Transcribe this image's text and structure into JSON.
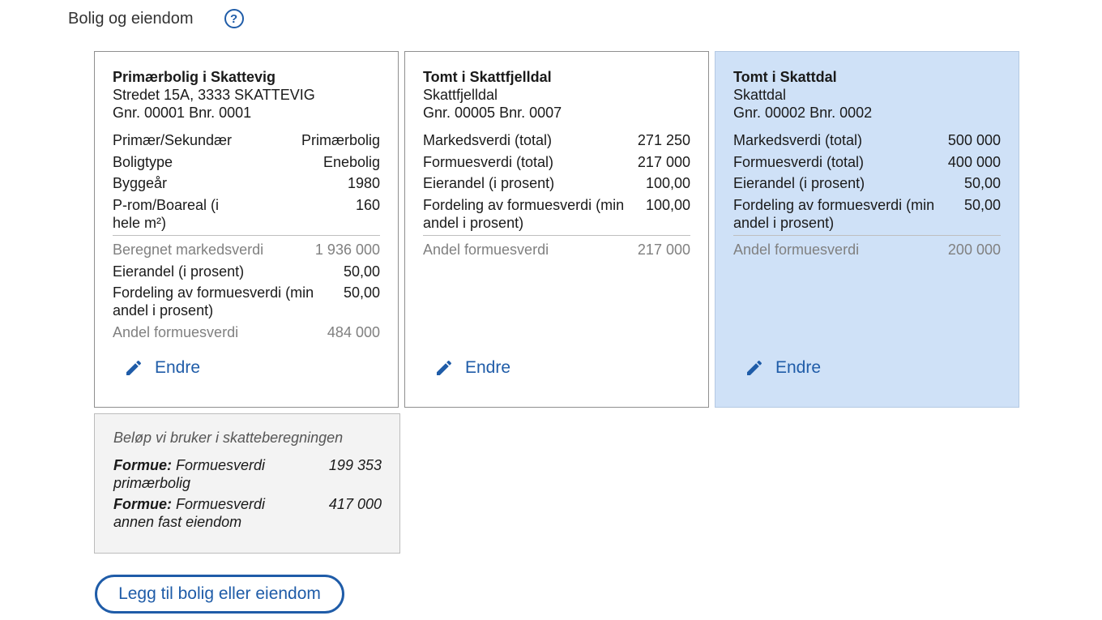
{
  "section": {
    "title": "Bolig og eiendom",
    "help_icon": "?"
  },
  "cards": [
    {
      "title": "Primærbolig i Skattevig",
      "line1": "Stredet 15A, 3333 SKATTEVIG",
      "line2": "Gnr. 00001 Bnr. 0001",
      "rows": [
        {
          "label": "Primær/Sekundær",
          "value": "Primærbolig"
        },
        {
          "label": "Boligtype",
          "value": "Enebolig"
        },
        {
          "label": "Byggeår",
          "value": "1980"
        },
        {
          "label": "P-rom/Boareal (i hele m²)",
          "value": "160"
        }
      ],
      "computed": {
        "label": "Beregnet markedsverdi",
        "value": "1 936 000"
      },
      "rows2": [
        {
          "label": "Eierandel (i prosent)",
          "value": "50,00"
        },
        {
          "label": "Fordeling av formuesverdi (min andel i prosent)",
          "value": "50,00"
        }
      ],
      "share": {
        "label": "Andel formuesverdi",
        "value": "484 000"
      },
      "edit_label": "Endre"
    },
    {
      "title": "Tomt i Skattfjelldal",
      "line1": "Skattfjelldal",
      "line2": "Gnr. 00005 Bnr. 0007",
      "rows": [
        {
          "label": "Markedsverdi (total)",
          "value": "271 250"
        },
        {
          "label": "Formuesverdi (total)",
          "value": "217 000"
        },
        {
          "label": "Eierandel (i prosent)",
          "value": "100,00"
        },
        {
          "label": "Fordeling av formuesverdi (min andel i prosent)",
          "value": "100,00"
        }
      ],
      "share": {
        "label": "Andel formuesverdi",
        "value": "217 000"
      },
      "edit_label": "Endre"
    },
    {
      "title": "Tomt i Skattdal",
      "line1": "Skattdal",
      "line2": "Gnr. 00002 Bnr. 0002",
      "rows": [
        {
          "label": "Markedsverdi (total)",
          "value": "500 000"
        },
        {
          "label": "Formuesverdi (total)",
          "value": "400 000"
        },
        {
          "label": "Eierandel (i prosent)",
          "value": "50,00"
        },
        {
          "label": "Fordeling av formuesverdi (min andel i prosent)",
          "value": "50,00"
        }
      ],
      "share": {
        "label": "Andel formuesverdi",
        "value": "200 000"
      },
      "edit_label": "Endre"
    }
  ],
  "summary": {
    "heading": "Beløp vi bruker i skatteberegningen",
    "rows": [
      {
        "label_bold": "Formue:",
        "label_rest": "Formuesverdi primærbolig",
        "value": "199 353"
      },
      {
        "label_bold": "Formue:",
        "label_rest": "Formuesverdi annen fast eiendom",
        "value": "417 000"
      }
    ]
  },
  "add_button": {
    "label": "Legg til bolig eller eiendom"
  },
  "colors": {
    "accent": "#1f5ca8",
    "highlight_card": "#cfe1f7",
    "summary_bg": "#f3f3f3",
    "muted_text": "#808080"
  }
}
